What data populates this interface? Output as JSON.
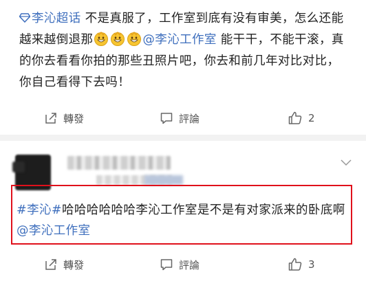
{
  "post1": {
    "topic_link": "李沁超话",
    "text_before_emoji": " 不是真服了，工作室到底有没有审美，怎么还能越来越倒退那",
    "mention": "@李沁工作室",
    "text_after_mention": " 能干干，不能干滚，真的你去看看你拍的那些丑照片吧，你去和前几年对比对比，你自己看得下去吗！",
    "emoji_count": 3,
    "actions": {
      "repost_label": "轉發",
      "comment_label": "評論",
      "like_count": "2"
    }
  },
  "post2": {
    "hashtag": "#李沁#",
    "text": "哈哈哈哈哈哈李沁工作室是不是有对家派来的卧底啊",
    "mention": "@李沁工作室",
    "actions": {
      "repost_label": "轉發",
      "comment_label": "評論",
      "like_count": "3"
    }
  },
  "colors": {
    "link": "#3f6fbd",
    "highlight_border": "#e0101b",
    "background": "#f2f2f2"
  }
}
